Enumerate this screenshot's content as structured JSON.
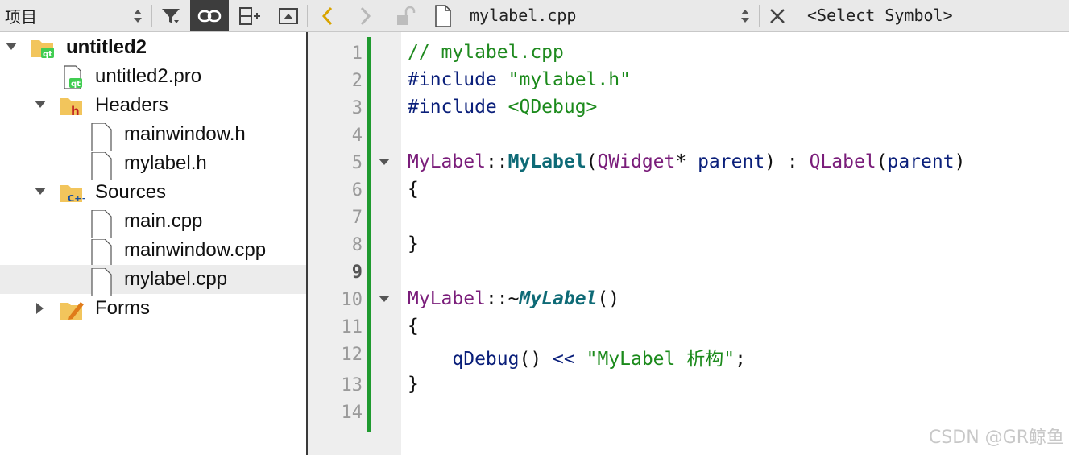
{
  "toolbar": {
    "project_title": "项目",
    "file_name": "mylabel.cpp",
    "symbol_selector": "<Select Symbol>"
  },
  "tree": {
    "root": "untitled2",
    "pro_file": "untitled2.pro",
    "headers_label": "Headers",
    "header_files": [
      "mainwindow.h",
      "mylabel.h"
    ],
    "sources_label": "Sources",
    "source_files": [
      "main.cpp",
      "mainwindow.cpp",
      "mylabel.cpp"
    ],
    "forms_label": "Forms",
    "selected": "mylabel.cpp"
  },
  "editor": {
    "current_line": "9",
    "line_numbers": [
      "1",
      "2",
      "3",
      "4",
      "5",
      "6",
      "7",
      "8",
      "9",
      "10",
      "11",
      "12",
      "13",
      "14"
    ],
    "code": {
      "l1": "// mylabel.cpp",
      "l2_kw": "#include ",
      "l2_str": "\"mylabel.h\"",
      "l3_kw": "#include ",
      "l3_str": "<QDebug>",
      "l5_cls": "MyLabel",
      "l5_sep": "::",
      "l5_fn": "MyLabel",
      "l5_p1": "(",
      "l5_type": "QWidget",
      "l5_star": "* ",
      "l5_param": "parent",
      "l5_p2": ") : ",
      "l5_base": "QLabel",
      "l5_p3": "(",
      "l5_arg": "parent",
      "l5_p4": ")",
      "l6": "{",
      "l8": "}",
      "l10_cls": "MyLabel",
      "l10_sep": "::~",
      "l10_fn": "MyLabel",
      "l10_p": "()",
      "l11": "{",
      "l12_indent": "    ",
      "l12_call": "qDebug",
      "l12_p": "() ",
      "l12_op": "<<",
      "l12_sp": " ",
      "l12_str": "\"MyLabel 析构\"",
      "l12_end": ";",
      "l13": "}"
    }
  },
  "watermark": "CSDN @GR鲸鱼"
}
